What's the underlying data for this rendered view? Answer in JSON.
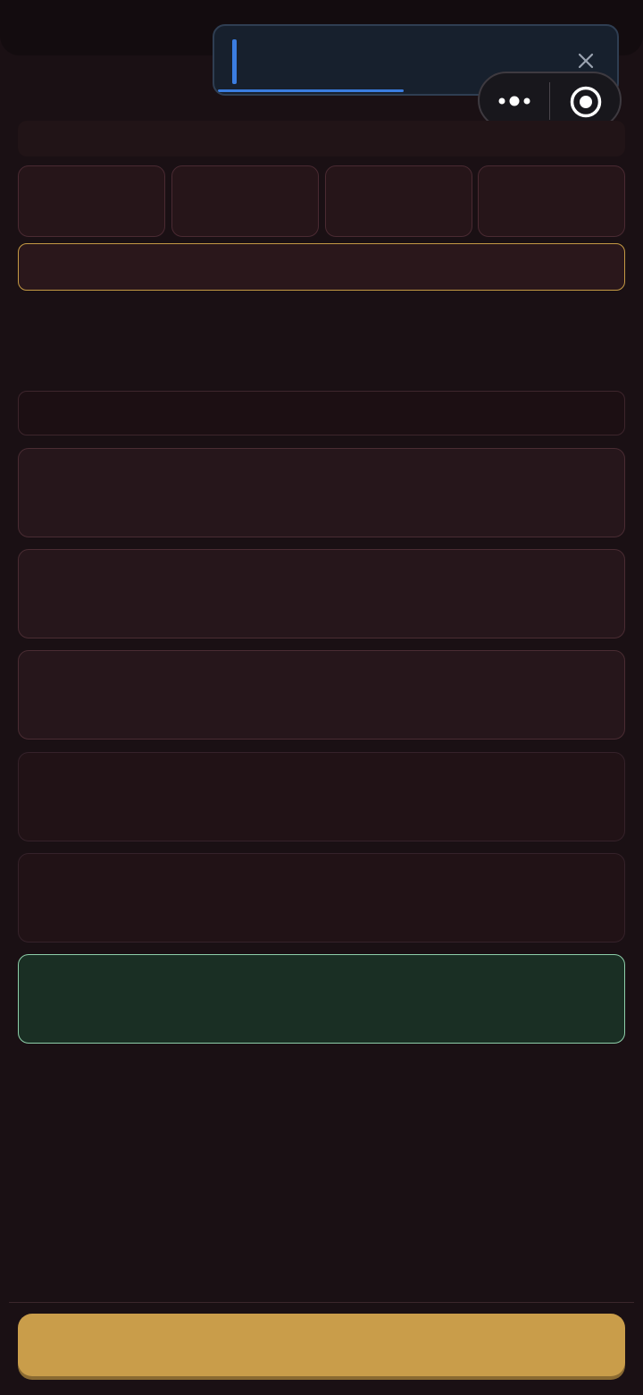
{
  "colors": {
    "background": "#1a1014",
    "accent_gold": "#c99d4a",
    "accent_green_border": "#8ecfaa",
    "toast_accent": "#3b7de0"
  },
  "toast": {
    "text": "",
    "close_icon": "close-icon",
    "progress_fraction": 0.47
  },
  "capsule": {
    "more_icon": "more-dots-icon",
    "target_icon": "target-icon"
  },
  "strip": {
    "text": ""
  },
  "tiles": [
    {
      "label": ""
    },
    {
      "label": ""
    },
    {
      "label": ""
    },
    {
      "label": ""
    }
  ],
  "gold_field": {
    "value": ""
  },
  "section_header": {
    "text": ""
  },
  "cards": [
    {
      "label": ""
    },
    {
      "label": ""
    },
    {
      "label": ""
    },
    {
      "label": ""
    },
    {
      "label": ""
    },
    {
      "label": ""
    }
  ],
  "primary_button": {
    "label": ""
  }
}
